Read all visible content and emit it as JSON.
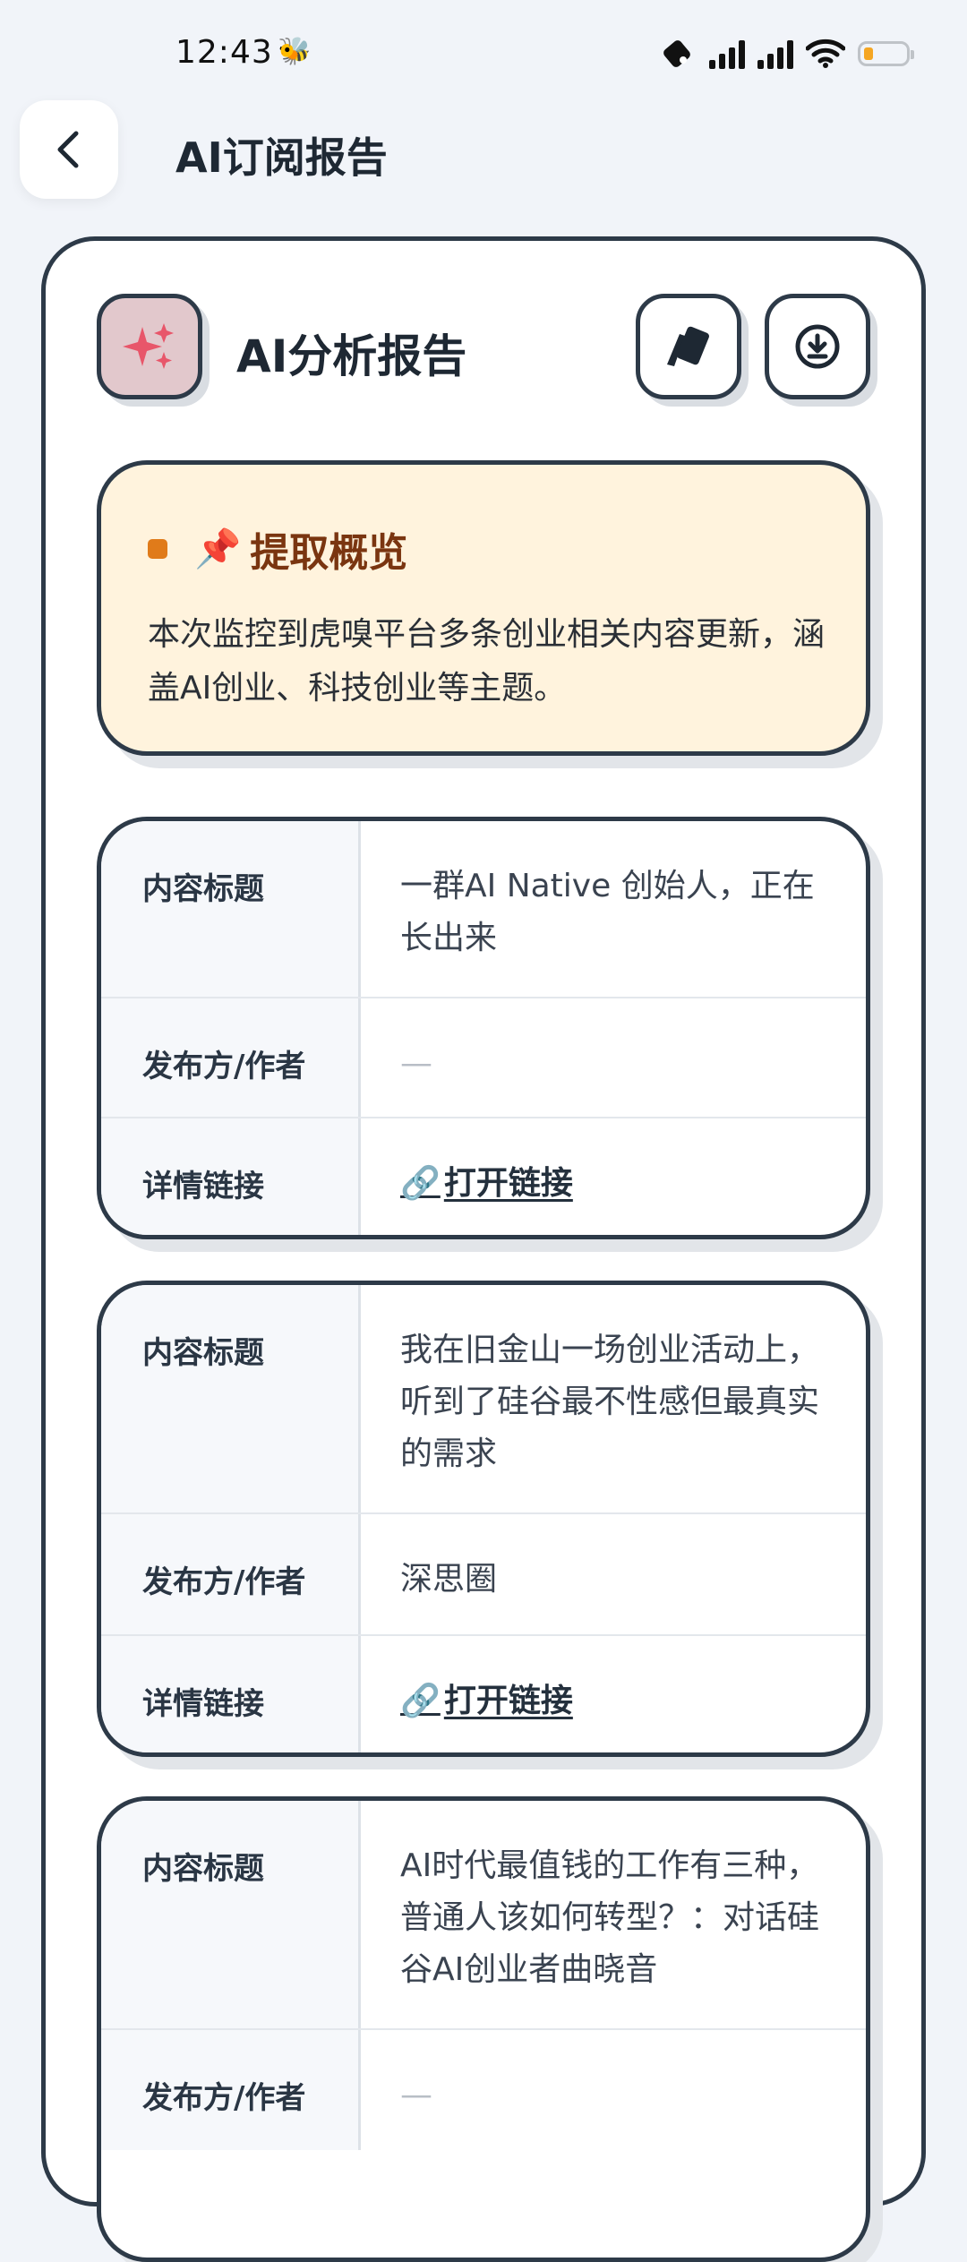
{
  "status": {
    "time": "12:43"
  },
  "header": {
    "title": "AI订阅报告"
  },
  "report": {
    "title": "AI分析报告",
    "summary_title": "提取概览",
    "summary_text": "本次监控到虎嗅平台多条创业相关内容更新，涵盖AI创业、科技创业等主题。"
  },
  "labels": {
    "content_title": "内容标题",
    "publisher": "发布方/作者",
    "detail_link": "详情链接",
    "open_link": "打开链接"
  },
  "items": [
    {
      "title": "一群AI Native 创始人，正在长出来",
      "publisher": "—"
    },
    {
      "title": "我在旧金山一场创业活动上，听到了硅谷最不性感但最真实的需求",
      "publisher": "深思圈"
    },
    {
      "title": "AI时代最值钱的工作有三种，普通人该如何转型？：对话硅谷AI创业者曲晓音",
      "publisher": "—"
    }
  ],
  "colors": {
    "accent_orange": "#e07b1a",
    "summary_bg": "#fff3dd",
    "border": "#2d3a48",
    "icon_pink": "#e8566a"
  }
}
